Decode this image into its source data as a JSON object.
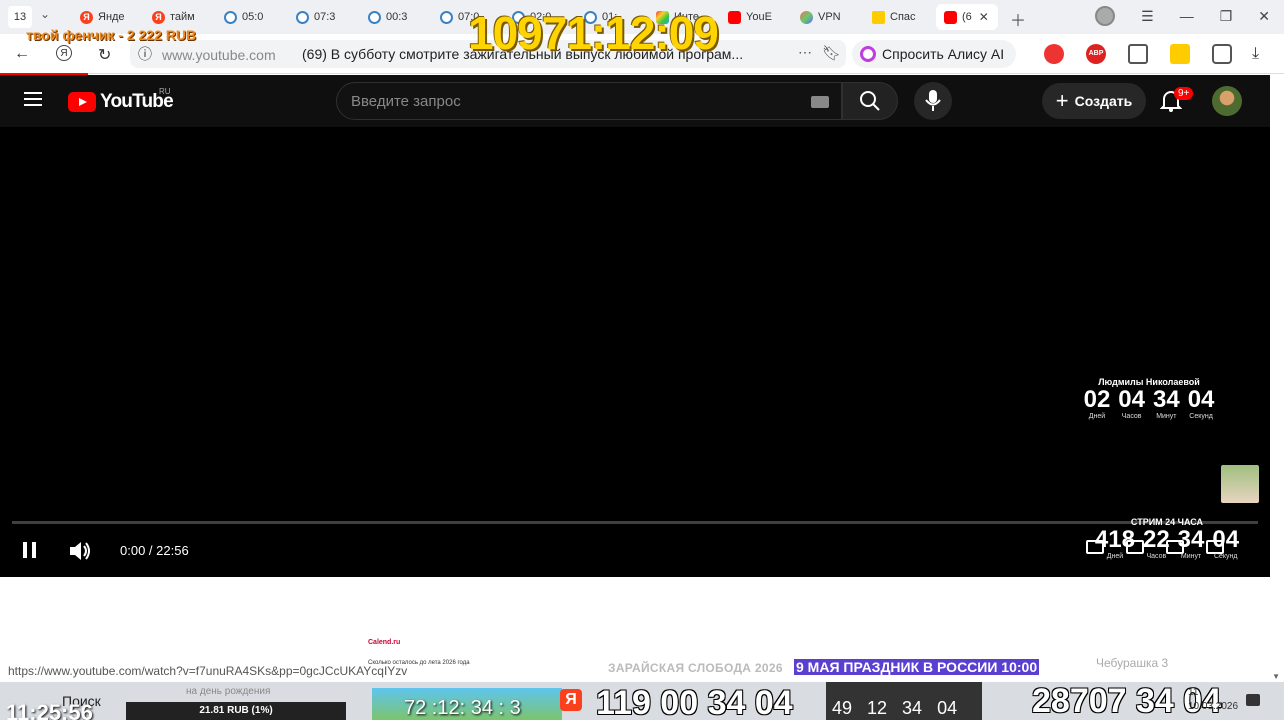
{
  "browser": {
    "tab_counter": "13",
    "tabs": [
      {
        "label": "Янде",
        "icon": "yandex-icon"
      },
      {
        "label": "тайм",
        "icon": "yandex-icon"
      },
      {
        "label": "05:0",
        "icon": "clock-icon"
      },
      {
        "label": "07:3",
        "icon": "clock-icon"
      },
      {
        "label": "00:3",
        "icon": "clock-icon"
      },
      {
        "label": "07:0",
        "icon": "clock-icon"
      },
      {
        "label": "02:0",
        "icon": "clock-icon"
      },
      {
        "label": "01:",
        "icon": "clock-icon"
      },
      {
        "label": "Инте",
        "icon": "rainbow-icon"
      },
      {
        "label": "YouE",
        "icon": "youtube-icon"
      },
      {
        "label": "VPN",
        "icon": "vpn-icon"
      },
      {
        "label": "Спас",
        "icon": "star-icon"
      },
      {
        "label": "(6",
        "icon": "youtube-icon",
        "active": true
      }
    ],
    "url_host": "www.youtube.com",
    "page_title": "(69) В субботу смотрите зажигательный выпуск любимой програм...",
    "alice_label": "Спросить Алису AI",
    "extension_label_1": "ABP",
    "status_url": "https://www.youtube.com/watch?v=f7unuRA4SKs&pp=0gcJCcUKAYcqIYzv"
  },
  "overlay": {
    "big_timer": "10971:12:09",
    "donation_text": "твой фенчик - 2 222 RUB"
  },
  "youtube": {
    "logo_text": "YouTube",
    "region": "RU",
    "search_placeholder": "Введите запрос",
    "create_label": "Создать",
    "notification_count": "9+"
  },
  "player": {
    "current_time": "0:00 / 22:56",
    "countdown_1": {
      "title": "Людмилы Николаевой",
      "values": [
        "02",
        "04",
        "34",
        "04"
      ],
      "labels": [
        "Дней",
        "Часов",
        "Минут",
        "Секунд"
      ]
    },
    "countdown_2": {
      "title": "СТРИМ 24 ЧАСА",
      "values": [
        "418",
        "22",
        "34",
        "04"
      ],
      "labels": [
        "Дней",
        "Часов",
        "Минут",
        "Секунд"
      ]
    }
  },
  "lower": {
    "mini_page_logo": "Calend.ru",
    "mini_page_text": "Сколько осталось до лета 2026 года",
    "news_1": "ЗАРАЙСКАЯ СЛОБОДА 2026",
    "news_2": "9 МАЯ ПРАЗДНИК В РОССИИ 10:00",
    "news_3": "Чебурашка 3"
  },
  "taskbar": {
    "clock_left": "11:25:56",
    "search_label": "Поиск",
    "birthday_text": "на день рождения",
    "rub_text": "21.81 RUB (1%)",
    "photo_timer": "72 :12: 34 : 3",
    "big_timer_1": "119 00 34 04",
    "panel_timer": "49 12 34 04",
    "big_timer_2": "28707 34 04",
    "date_line_1": "11",
    "date_line_2": "10.03.2026"
  }
}
